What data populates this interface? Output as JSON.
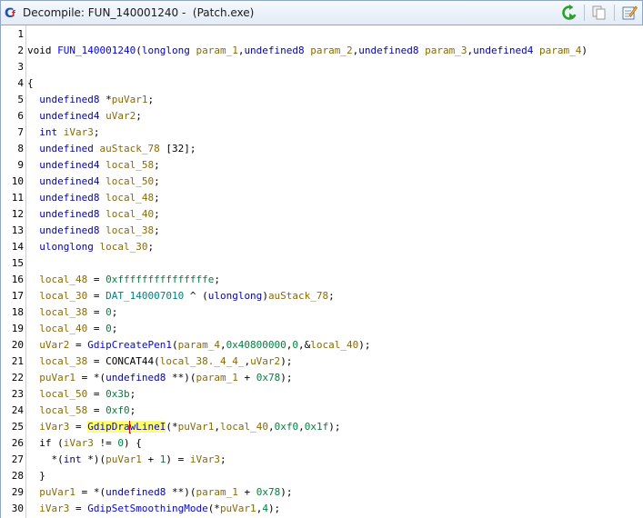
{
  "window": {
    "title": "Decompile: FUN_140001240 -  (Patch.exe)"
  },
  "toolbar": {
    "refresh_icon": "refresh-icon",
    "copy_icon": "copy-icon",
    "edit_icon": "edit-icon"
  },
  "colors": {
    "type": "#0000c0",
    "variable": "#8a6a00",
    "function": "#0000ff",
    "global": "#008080",
    "highlight": "#ffff66",
    "cursor": "#e00000"
  },
  "lines": [
    {
      "n": "1",
      "segs": []
    },
    {
      "n": "2",
      "segs": [
        {
          "c": "kw",
          "t": "void "
        },
        {
          "c": "f",
          "t": "FUN_140001240"
        },
        {
          "c": "kw",
          "t": "("
        },
        {
          "c": "t",
          "t": "longlong"
        },
        {
          "c": "kw",
          "t": " "
        },
        {
          "c": "v",
          "t": "param_1"
        },
        {
          "c": "kw",
          "t": ","
        },
        {
          "c": "t",
          "t": "undefined8"
        },
        {
          "c": "kw",
          "t": " "
        },
        {
          "c": "v",
          "t": "param_2"
        },
        {
          "c": "kw",
          "t": ","
        },
        {
          "c": "t",
          "t": "undefined8"
        },
        {
          "c": "kw",
          "t": " "
        },
        {
          "c": "v",
          "t": "param_3"
        },
        {
          "c": "kw",
          "t": ","
        },
        {
          "c": "t",
          "t": "undefined4"
        },
        {
          "c": "kw",
          "t": " "
        },
        {
          "c": "v",
          "t": "param_4"
        },
        {
          "c": "kw",
          "t": ")"
        }
      ]
    },
    {
      "n": "3",
      "segs": []
    },
    {
      "n": "4",
      "segs": [
        {
          "c": "kw",
          "t": "{"
        }
      ]
    },
    {
      "n": "5",
      "segs": [
        {
          "c": "t",
          "t": "  undefined8"
        },
        {
          "c": "kw",
          "t": " *"
        },
        {
          "c": "v",
          "t": "puVar1"
        },
        {
          "c": "kw",
          "t": ";"
        }
      ]
    },
    {
      "n": "6",
      "segs": [
        {
          "c": "t",
          "t": "  undefined4"
        },
        {
          "c": "kw",
          "t": " "
        },
        {
          "c": "v",
          "t": "uVar2"
        },
        {
          "c": "kw",
          "t": ";"
        }
      ]
    },
    {
      "n": "7",
      "segs": [
        {
          "c": "t",
          "t": "  int"
        },
        {
          "c": "kw",
          "t": " "
        },
        {
          "c": "v",
          "t": "iVar3"
        },
        {
          "c": "kw",
          "t": ";"
        }
      ]
    },
    {
      "n": "8",
      "segs": [
        {
          "c": "t",
          "t": "  undefined"
        },
        {
          "c": "kw",
          "t": " "
        },
        {
          "c": "v",
          "t": "auStack_78"
        },
        {
          "c": "kw",
          "t": " [32];"
        }
      ]
    },
    {
      "n": "9",
      "segs": [
        {
          "c": "t",
          "t": "  undefined4"
        },
        {
          "c": "kw",
          "t": " "
        },
        {
          "c": "v",
          "t": "local_58"
        },
        {
          "c": "kw",
          "t": ";"
        }
      ]
    },
    {
      "n": "10",
      "segs": [
        {
          "c": "t",
          "t": "  undefined4"
        },
        {
          "c": "kw",
          "t": " "
        },
        {
          "c": "v",
          "t": "local_50"
        },
        {
          "c": "kw",
          "t": ";"
        }
      ]
    },
    {
      "n": "11",
      "segs": [
        {
          "c": "t",
          "t": "  undefined8"
        },
        {
          "c": "kw",
          "t": " "
        },
        {
          "c": "v",
          "t": "local_48"
        },
        {
          "c": "kw",
          "t": ";"
        }
      ]
    },
    {
      "n": "12",
      "segs": [
        {
          "c": "t",
          "t": "  undefined8"
        },
        {
          "c": "kw",
          "t": " "
        },
        {
          "c": "v",
          "t": "local_40"
        },
        {
          "c": "kw",
          "t": ";"
        }
      ]
    },
    {
      "n": "13",
      "segs": [
        {
          "c": "t",
          "t": "  undefined8"
        },
        {
          "c": "kw",
          "t": " "
        },
        {
          "c": "v",
          "t": "local_38"
        },
        {
          "c": "kw",
          "t": ";"
        }
      ]
    },
    {
      "n": "14",
      "segs": [
        {
          "c": "t",
          "t": "  ulonglong"
        },
        {
          "c": "kw",
          "t": " "
        },
        {
          "c": "v",
          "t": "local_30"
        },
        {
          "c": "kw",
          "t": ";"
        }
      ]
    },
    {
      "n": "15",
      "segs": []
    },
    {
      "n": "16",
      "segs": [
        {
          "c": "v",
          "t": "  local_48"
        },
        {
          "c": "kw",
          "t": " = "
        },
        {
          "c": "n",
          "t": "0xfffffffffffffffe"
        },
        {
          "c": "kw",
          "t": ";"
        }
      ]
    },
    {
      "n": "17",
      "segs": [
        {
          "c": "v",
          "t": "  local_30"
        },
        {
          "c": "kw",
          "t": " = "
        },
        {
          "c": "g",
          "t": "DAT_140007010"
        },
        {
          "c": "kw",
          "t": " ^ ("
        },
        {
          "c": "t",
          "t": "ulonglong"
        },
        {
          "c": "kw",
          "t": ")"
        },
        {
          "c": "v",
          "t": "auStack_78"
        },
        {
          "c": "kw",
          "t": ";"
        }
      ]
    },
    {
      "n": "18",
      "segs": [
        {
          "c": "v",
          "t": "  local_38"
        },
        {
          "c": "kw",
          "t": " = "
        },
        {
          "c": "n",
          "t": "0"
        },
        {
          "c": "kw",
          "t": ";"
        }
      ]
    },
    {
      "n": "19",
      "segs": [
        {
          "c": "v",
          "t": "  local_40"
        },
        {
          "c": "kw",
          "t": " = "
        },
        {
          "c": "n",
          "t": "0"
        },
        {
          "c": "kw",
          "t": ";"
        }
      ]
    },
    {
      "n": "20",
      "segs": [
        {
          "c": "v",
          "t": "  uVar2"
        },
        {
          "c": "kw",
          "t": " = "
        },
        {
          "c": "f",
          "t": "GdipCreatePen1"
        },
        {
          "c": "kw",
          "t": "("
        },
        {
          "c": "v",
          "t": "param_4"
        },
        {
          "c": "kw",
          "t": ","
        },
        {
          "c": "n",
          "t": "0x40800000"
        },
        {
          "c": "kw",
          "t": ","
        },
        {
          "c": "n",
          "t": "0"
        },
        {
          "c": "kw",
          "t": ",&"
        },
        {
          "c": "v",
          "t": "local_40"
        },
        {
          "c": "kw",
          "t": ");"
        }
      ]
    },
    {
      "n": "21",
      "segs": [
        {
          "c": "v",
          "t": "  local_38"
        },
        {
          "c": "kw",
          "t": " = "
        },
        {
          "c": "kw",
          "t": "CONCAT44"
        },
        {
          "c": "kw",
          "t": "("
        },
        {
          "c": "v",
          "t": "local_38._4_4_"
        },
        {
          "c": "kw",
          "t": ","
        },
        {
          "c": "v",
          "t": "uVar2"
        },
        {
          "c": "kw",
          "t": ");"
        }
      ]
    },
    {
      "n": "22",
      "segs": [
        {
          "c": "v",
          "t": "  puVar1"
        },
        {
          "c": "kw",
          "t": " = *("
        },
        {
          "c": "t",
          "t": "undefined8"
        },
        {
          "c": "kw",
          "t": " **)("
        },
        {
          "c": "v",
          "t": "param_1"
        },
        {
          "c": "kw",
          "t": " + "
        },
        {
          "c": "n",
          "t": "0x78"
        },
        {
          "c": "kw",
          "t": ");"
        }
      ]
    },
    {
      "n": "23",
      "segs": [
        {
          "c": "v",
          "t": "  local_50"
        },
        {
          "c": "kw",
          "t": " = "
        },
        {
          "c": "n",
          "t": "0x3b"
        },
        {
          "c": "kw",
          "t": ";"
        }
      ]
    },
    {
      "n": "24",
      "segs": [
        {
          "c": "v",
          "t": "  local_58"
        },
        {
          "c": "kw",
          "t": " = "
        },
        {
          "c": "n",
          "t": "0xf0"
        },
        {
          "c": "kw",
          "t": ";"
        }
      ]
    },
    {
      "n": "25",
      "segs": [
        {
          "c": "v",
          "t": "  iVar3"
        },
        {
          "c": "kw",
          "t": " = "
        },
        {
          "c": "f hl",
          "t": "GdipDra"
        },
        {
          "c": "cursor",
          "t": ""
        },
        {
          "c": "f hl",
          "t": "wLineI"
        },
        {
          "c": "kw",
          "t": "(*"
        },
        {
          "c": "v",
          "t": "puVar1"
        },
        {
          "c": "kw",
          "t": ","
        },
        {
          "c": "v",
          "t": "local_40"
        },
        {
          "c": "kw",
          "t": ","
        },
        {
          "c": "n",
          "t": "0xf0"
        },
        {
          "c": "kw",
          "t": ","
        },
        {
          "c": "n",
          "t": "0x1f"
        },
        {
          "c": "kw",
          "t": ");"
        }
      ]
    },
    {
      "n": "26",
      "segs": [
        {
          "c": "kw",
          "t": "  if ("
        },
        {
          "c": "v",
          "t": "iVar3"
        },
        {
          "c": "kw",
          "t": " != "
        },
        {
          "c": "n",
          "t": "0"
        },
        {
          "c": "kw",
          "t": ") {"
        }
      ]
    },
    {
      "n": "27",
      "segs": [
        {
          "c": "kw",
          "t": "    *("
        },
        {
          "c": "t",
          "t": "int"
        },
        {
          "c": "kw",
          "t": " *)("
        },
        {
          "c": "v",
          "t": "puVar1"
        },
        {
          "c": "kw",
          "t": " + "
        },
        {
          "c": "n",
          "t": "1"
        },
        {
          "c": "kw",
          "t": ") = "
        },
        {
          "c": "v",
          "t": "iVar3"
        },
        {
          "c": "kw",
          "t": ";"
        }
      ]
    },
    {
      "n": "28",
      "segs": [
        {
          "c": "kw",
          "t": "  }"
        }
      ]
    },
    {
      "n": "29",
      "segs": [
        {
          "c": "v",
          "t": "  puVar1"
        },
        {
          "c": "kw",
          "t": " = *("
        },
        {
          "c": "t",
          "t": "undefined8"
        },
        {
          "c": "kw",
          "t": " **)("
        },
        {
          "c": "v",
          "t": "param_1"
        },
        {
          "c": "kw",
          "t": " + "
        },
        {
          "c": "n",
          "t": "0x78"
        },
        {
          "c": "kw",
          "t": ");"
        }
      ]
    },
    {
      "n": "30",
      "segs": [
        {
          "c": "v",
          "t": "  iVar3"
        },
        {
          "c": "kw",
          "t": " = "
        },
        {
          "c": "f",
          "t": "GdipSetSmoothingMode"
        },
        {
          "c": "kw",
          "t": "(*"
        },
        {
          "c": "v",
          "t": "puVar1"
        },
        {
          "c": "kw",
          "t": ","
        },
        {
          "c": "n",
          "t": "4"
        },
        {
          "c": "kw",
          "t": ");"
        }
      ]
    }
  ]
}
